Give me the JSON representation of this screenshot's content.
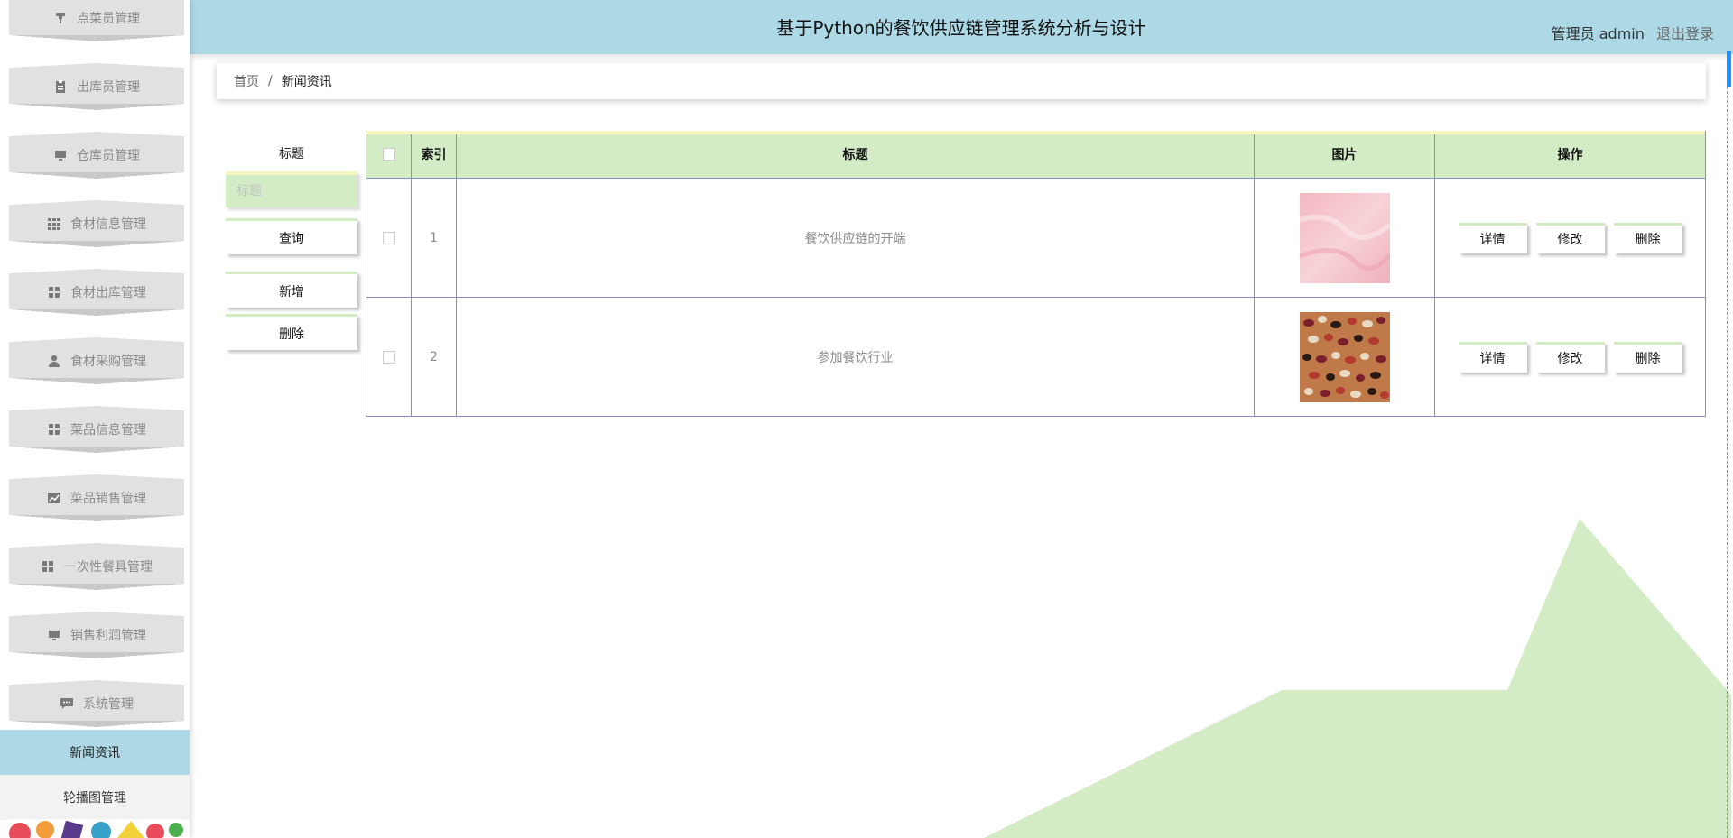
{
  "header": {
    "title": "基于Python的餐饮供应链管理系统分析与设计",
    "user_label": "管理员 admin",
    "logout_label": "退出登录"
  },
  "sidebar": {
    "items": [
      {
        "label": "点菜员管理",
        "icon": "podium-icon"
      },
      {
        "label": "出库员管理",
        "icon": "clipboard-icon"
      },
      {
        "label": "仓库员管理",
        "icon": "monitor-icon"
      },
      {
        "label": "食材信息管理",
        "icon": "grid-icon"
      },
      {
        "label": "食材出库管理",
        "icon": "apps-icon"
      },
      {
        "label": "食材采购管理",
        "icon": "user-icon"
      },
      {
        "label": "菜品信息管理",
        "icon": "apps-icon"
      },
      {
        "label": "菜品销售管理",
        "icon": "chart-icon"
      },
      {
        "label": "一次性餐具管理",
        "icon": "apps-icon"
      },
      {
        "label": "销售利润管理",
        "icon": "monitor-icon"
      },
      {
        "label": "系统管理",
        "icon": "chat-icon"
      }
    ],
    "sub_items": [
      {
        "label": "新闻资讯",
        "active": true
      },
      {
        "label": "轮播图管理",
        "active": false
      }
    ]
  },
  "breadcrumb": {
    "home": "首页",
    "separator": "/",
    "current": "新闻资讯"
  },
  "filter": {
    "label": "标题",
    "placeholder": "标题",
    "search_label": "查询",
    "add_label": "新增",
    "delete_label": "删除"
  },
  "table": {
    "columns": [
      "索引",
      "标题",
      "图片",
      "操作"
    ],
    "rows": [
      {
        "index": "1",
        "title": "餐饮供应链的开端",
        "image": "pink-texture"
      },
      {
        "index": "2",
        "title": "参加餐饮行业",
        "image": "beans-photo"
      }
    ],
    "actions": {
      "detail": "详情",
      "edit": "修改",
      "delete": "删除"
    }
  },
  "colors": {
    "header_bg": "#add8e6",
    "accent_green": "#d4ecc6",
    "accent_yellow": "#f8f6c0",
    "table_border": "#8a8fbf"
  }
}
